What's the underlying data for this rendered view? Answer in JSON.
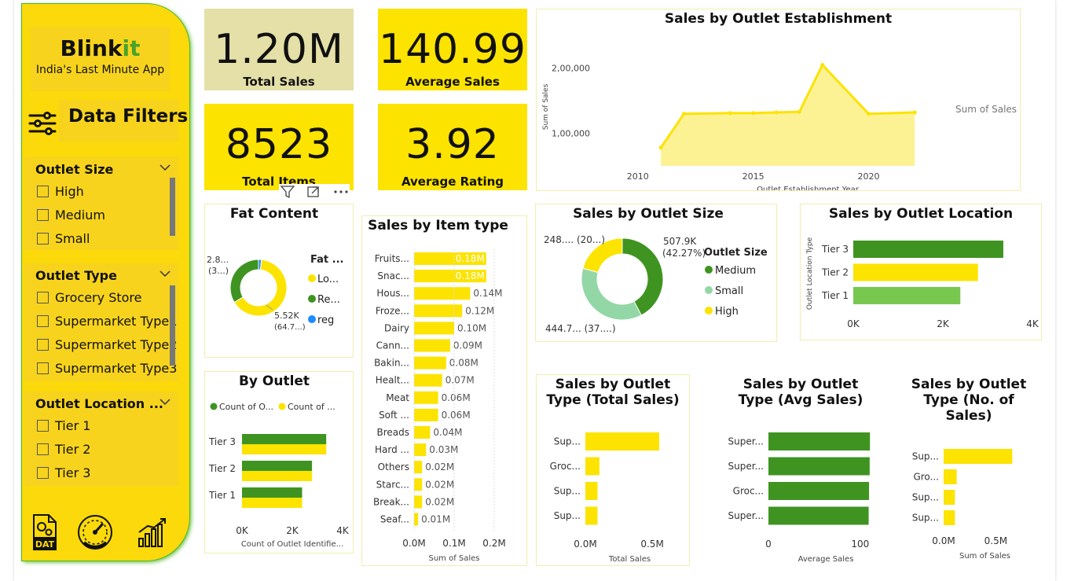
{
  "brand": {
    "name_main": "Blink",
    "name_accent": "it",
    "tagline": "India's Last Minute App"
  },
  "filters": {
    "title": "Data Filters",
    "groups": [
      {
        "title": "Outlet Size",
        "items": [
          "High",
          "Medium",
          "Small"
        ]
      },
      {
        "title": "Outlet Type",
        "items": [
          "Grocery Store",
          "Supermarket Type1",
          "Supermarket Type2",
          "Supermarket Type3"
        ]
      },
      {
        "title": "Outlet Location ...",
        "items": [
          "Tier 1",
          "Tier 2",
          "Tier 3"
        ]
      }
    ]
  },
  "nav_icons": [
    "data-icon",
    "gauge-icon",
    "bar-chart-icon"
  ],
  "nav_labels": {
    "data": "DAT"
  },
  "kpis": {
    "total_sales": {
      "value": "1.20M",
      "label": "Total Sales"
    },
    "average_sales": {
      "value": "140.99",
      "label": "Average Sales"
    },
    "total_items": {
      "value": "8523",
      "label": "Total Items"
    },
    "average_rating": {
      "value": "3.92",
      "label": "Average Rating"
    }
  },
  "colors": {
    "yellow": "#fce300",
    "green": "#3f9421",
    "light_green": "#93d7a7",
    "blue": "#1a8cff",
    "sidebar": "#fbd90a"
  },
  "chart_data": [
    {
      "id": "establishment",
      "type": "area",
      "title": "Sales by Outlet Establishment",
      "xlabel": "Outlet Establishment Year",
      "ylabel": "Sum of Sales",
      "series_label": "Sum of Sales",
      "x": [
        2011,
        2012,
        2014,
        2015,
        2016,
        2017,
        2018,
        2020,
        2022
      ],
      "y": [
        78000,
        130000,
        131000,
        131000,
        132000,
        133000,
        205000,
        130000,
        132000
      ],
      "x_ticks": [
        "2010",
        "2015",
        "2020"
      ],
      "y_ticks": [
        "1,00,000",
        "2,00,000"
      ]
    },
    {
      "id": "fat",
      "type": "pie",
      "title": "Fat Content",
      "legend_title": "Fat ...",
      "labels": [
        "Lo...",
        "Re...",
        "reg"
      ],
      "values": [
        64.7,
        33.6,
        1.7
      ],
      "data_labels": [
        "5.52K",
        "(64.7...)",
        "2.8...",
        "(3...)"
      ]
    },
    {
      "id": "item_type",
      "type": "bar",
      "title": "Sales by Item type",
      "xlabel": "Sum of Sales",
      "categories": [
        "Fruits...",
        "Snac...",
        "Hous...",
        "Froze...",
        "Dairy",
        "Cann...",
        "Bakin...",
        "Healt...",
        "Meat",
        "Soft ...",
        "Breads",
        "Hard ...",
        "Others",
        "Starc...",
        "Break...",
        "Seaf..."
      ],
      "values": [
        0.18,
        0.18,
        0.14,
        0.12,
        0.1,
        0.09,
        0.08,
        0.07,
        0.06,
        0.06,
        0.04,
        0.03,
        0.02,
        0.02,
        0.02,
        0.01
      ],
      "value_labels": [
        "0.18M",
        "0.18M",
        "0.14M",
        "0.12M",
        "0.10M",
        "0.09M",
        "0.08M",
        "0.07M",
        "0.06M",
        "0.06M",
        "0.04M",
        "0.03M",
        "0.02M",
        "0.02M",
        "0.02M",
        "0.01M"
      ],
      "x_ticks": [
        "0.0M",
        "0.1M",
        "0.2M"
      ],
      "xlim": [
        0,
        0.2
      ]
    },
    {
      "id": "outlet_size",
      "type": "pie",
      "title": "Sales by Outlet Size",
      "legend_title": "Outlet Size",
      "labels": [
        "Medium",
        "Small",
        "High"
      ],
      "values": [
        42.27,
        37.0,
        20.73
      ],
      "data_labels": [
        "507.9K",
        "(42.27%)",
        "444.7... (37....)",
        "248.... (20...)"
      ]
    },
    {
      "id": "location",
      "type": "bar",
      "title": "Sales by Outlet Location",
      "ylabel": "Outlet Location Type",
      "categories": [
        "Tier 3",
        "Tier 2",
        "Tier 1"
      ],
      "values": [
        3350,
        2785,
        2390
      ],
      "x_ticks": [
        "0K",
        "2K",
        "4K"
      ],
      "xlim": [
        0,
        4000
      ]
    },
    {
      "id": "by_outlet",
      "type": "bar",
      "title": "By Outlet",
      "xlabel": "Count of Outlet Identifie...",
      "legend": [
        "Count of O...",
        "Count of ..."
      ],
      "categories": [
        "Tier 3",
        "Tier 2",
        "Tier 1"
      ],
      "series": [
        {
          "values": [
            3350,
            2785,
            2390
          ]
        },
        {
          "values": [
            3350,
            2785,
            2390
          ]
        }
      ],
      "x_ticks": [
        "0K",
        "2K",
        "4K"
      ],
      "xlim": [
        0,
        4000
      ]
    },
    {
      "id": "type_total",
      "type": "bar",
      "title": "Sales by Outlet Type (Total Sales)",
      "xlabel": "Total Sales",
      "categories": [
        "Sup...",
        "Groc...",
        "Sup...",
        "Sup..."
      ],
      "values": [
        0.79,
        0.15,
        0.13,
        0.13
      ],
      "x_ticks": [
        "0.0M",
        "0.5M"
      ],
      "xlim": [
        0,
        0.95
      ]
    },
    {
      "id": "type_avg",
      "type": "bar",
      "title": "Sales by Outlet Type (Avg Sales)",
      "xlabel": "Average Sales",
      "categories": [
        "Super...",
        "Super...",
        "Groc...",
        "Super..."
      ],
      "values": [
        141.6,
        141.2,
        140.3,
        139.8
      ],
      "x_ticks": [
        "0",
        "100"
      ],
      "xlim": [
        0,
        160
      ]
    },
    {
      "id": "type_count",
      "type": "bar",
      "title": "Sales by Outlet Type (No. of Sales)",
      "xlabel": "Sum of Sales",
      "categories": [
        "Sup...",
        "Gro...",
        "Sup...",
        "Sup..."
      ],
      "values": [
        0.79,
        0.15,
        0.13,
        0.13
      ],
      "x_ticks": [
        "0.0M",
        "0.5M"
      ],
      "xlim": [
        0,
        0.95
      ]
    }
  ]
}
